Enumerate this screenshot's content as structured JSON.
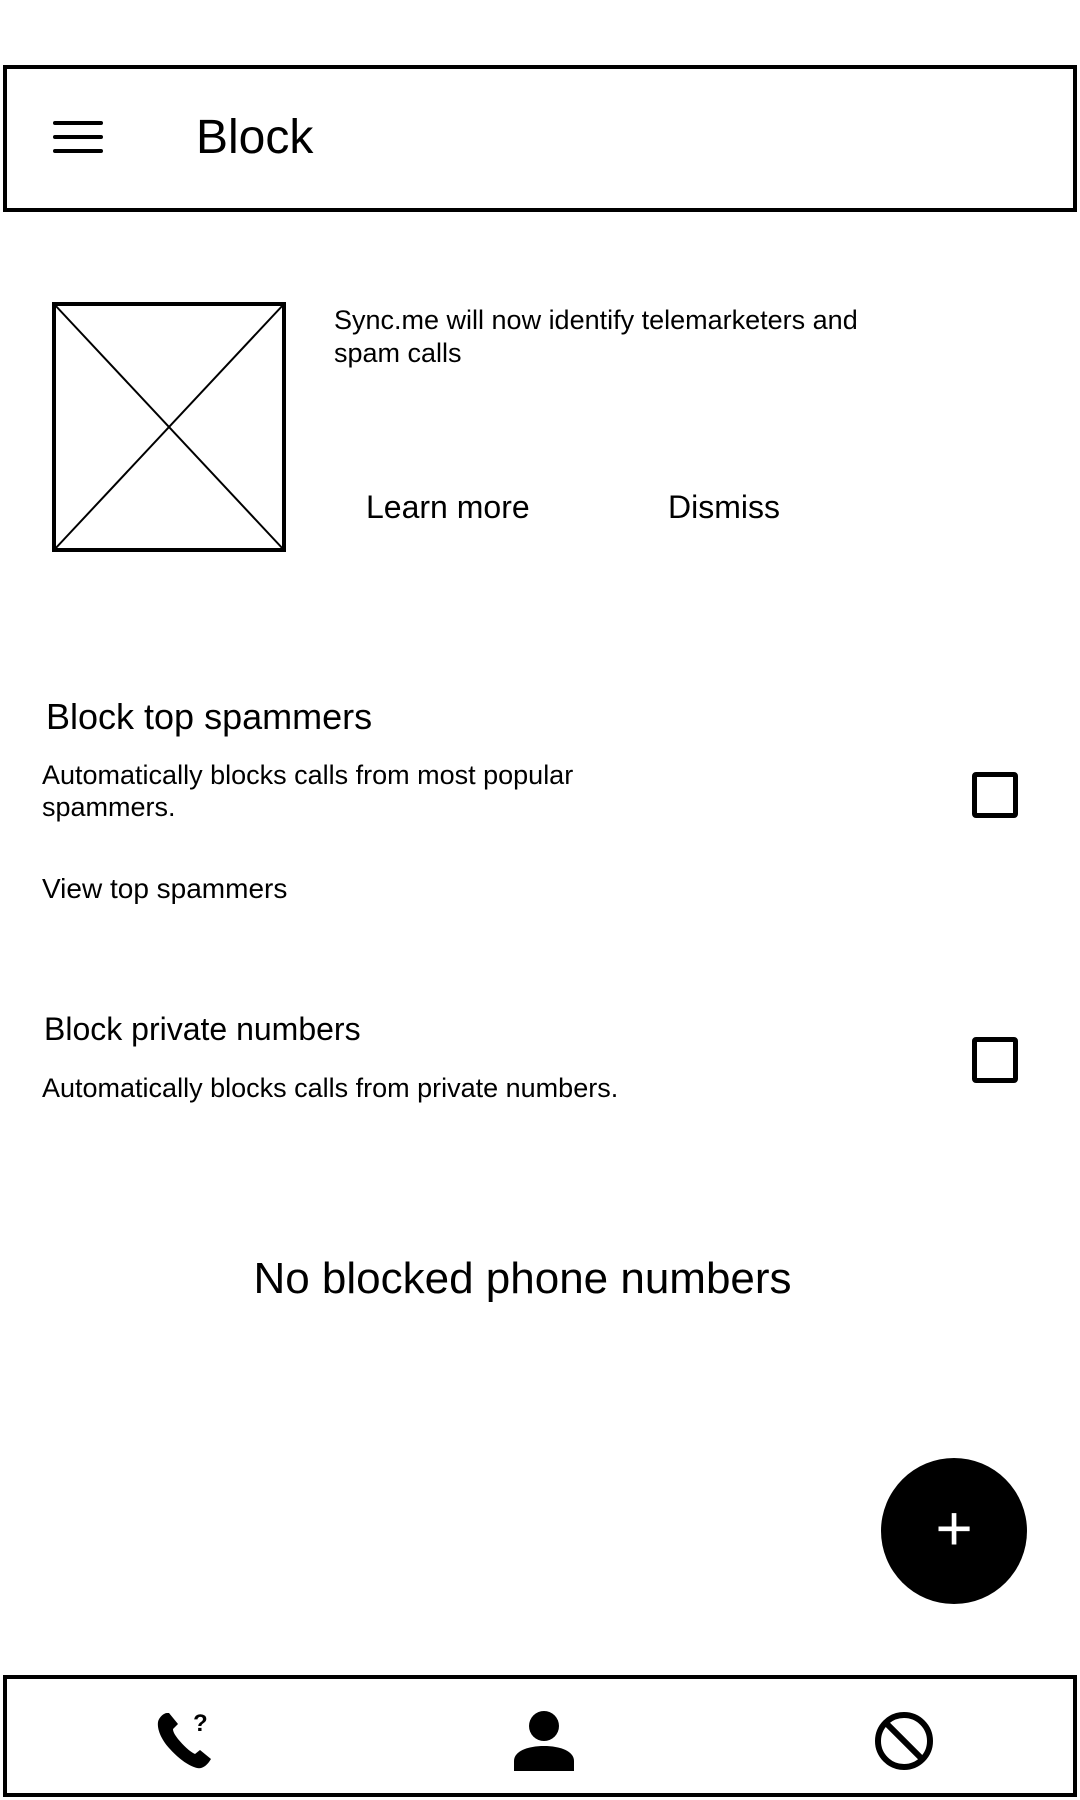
{
  "header": {
    "title": "Block",
    "menu_icon": "hamburger-menu-icon"
  },
  "banner": {
    "image_icon": "image-placeholder",
    "message": "Sync.me will now identify telemarketers and spam calls",
    "learn_more_label": "Learn more",
    "dismiss_label": "Dismiss"
  },
  "top_spammers": {
    "title": "Block top spammers",
    "description": "Automatically blocks calls from most popular spammers.",
    "checked": false,
    "view_link": "View top spammers"
  },
  "private_numbers": {
    "title": "Block private numbers",
    "description": "Automatically blocks calls from private numbers.",
    "checked": false
  },
  "empty_state": "No blocked phone numbers",
  "fab": {
    "label": "+",
    "icon": "add-icon"
  },
  "bottom_nav": {
    "items": [
      {
        "icon": "unknown-caller-phone-icon"
      },
      {
        "icon": "contacts-person-icon"
      },
      {
        "icon": "block-icon"
      }
    ]
  }
}
